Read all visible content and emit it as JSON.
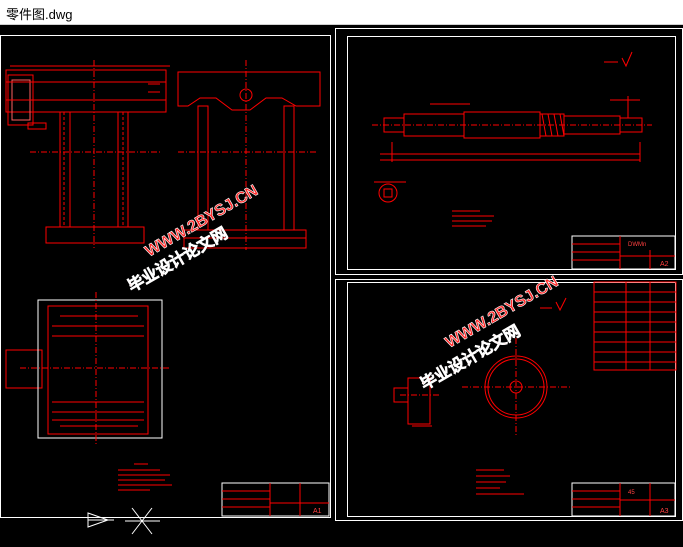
{
  "window": {
    "title": "零件图.dwg"
  },
  "watermark": {
    "text_cn": "毕业设计论文网",
    "text_url": "WWW.2BYSJ.CN"
  },
  "sheets": {
    "left": {
      "size": "A1"
    },
    "top_right": {
      "code": "DWMn",
      "size": "A2"
    },
    "bottom_right": {
      "code": "45",
      "size": "A3"
    }
  },
  "colors": {
    "background": "#000000",
    "frame": "#ffffff",
    "drawing": "#ff0000",
    "watermark": "#ff2a2a"
  }
}
